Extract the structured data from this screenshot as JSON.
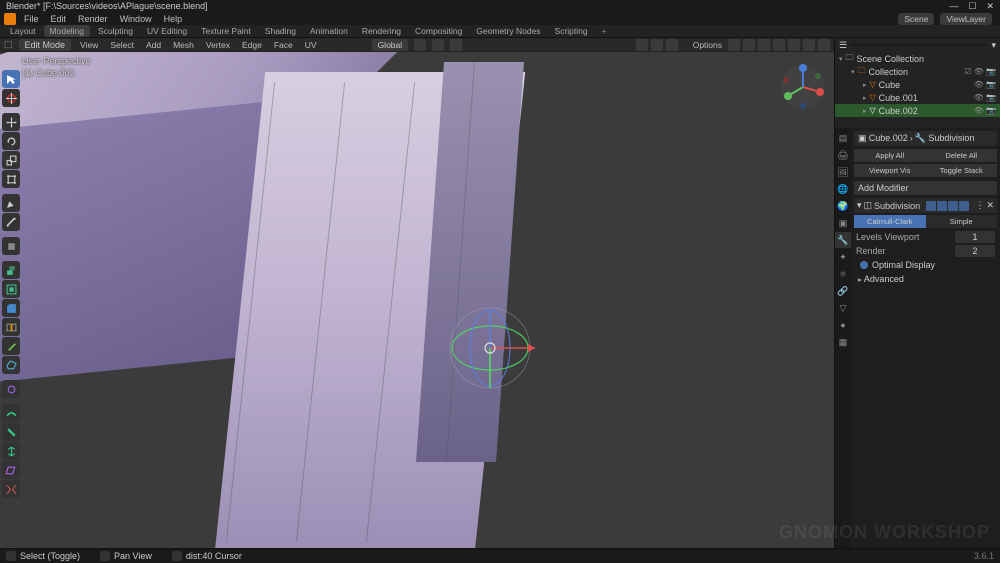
{
  "title": "Blender* [F:\\Sources\\videos\\APlague\\scene.blend]",
  "winbtns": [
    "—",
    "☐",
    "✕"
  ],
  "menu": [
    "File",
    "Edit",
    "Render",
    "Window",
    "Help"
  ],
  "workspaces": {
    "items": [
      "Layout",
      "Modeling",
      "Sculpting",
      "UV Editing",
      "Texture Paint",
      "Shading",
      "Animation",
      "Rendering",
      "Compositing",
      "Geometry Nodes",
      "Scripting"
    ],
    "active": 1,
    "plus": "+"
  },
  "scene_dd": "Scene",
  "viewlayer_dd": "ViewLayer",
  "viewport": {
    "mode_icon": "⬚",
    "mode": "Edit Mode",
    "menus": [
      "View",
      "Select",
      "Add",
      "Mesh",
      "Vertex",
      "Edge",
      "Face",
      "UV"
    ],
    "orient": "Global",
    "pivot": "⊙",
    "snap": "🧲",
    "overlay_line1": "User Perspective",
    "overlay_line2": "(1) Cube.002",
    "options": "Options",
    "version": "3.6.1"
  },
  "tools": [
    "select",
    "cursor",
    "move",
    "rotate",
    "scale",
    "transform",
    "annotate",
    "measure",
    "addcube",
    "extrude-region",
    "extrude-manifold",
    "inset",
    "bevel",
    "loopcut",
    "knife",
    "polybuild",
    "spin",
    "smooth",
    "slide-edge",
    "shrink",
    "shear",
    "rip",
    "rip-edge"
  ],
  "outliner": {
    "header": "Scene Collection",
    "rows": [
      {
        "depth": 1,
        "icon": "▸",
        "type": "📁",
        "label": "Collection",
        "toggles": "☑ 👁 📷"
      },
      {
        "depth": 2,
        "icon": "▾",
        "type": "▽",
        "label": "Cube",
        "toggles": "👁 📷"
      },
      {
        "depth": 2,
        "icon": "▾",
        "type": "▽",
        "label": "Cube.001",
        "toggles": "👁 📷"
      },
      {
        "depth": 2,
        "icon": "▾",
        "type": "▽",
        "label": "Cube.002",
        "toggles": "👁 📷",
        "sel": true
      }
    ]
  },
  "props": {
    "crumb_obj": "Cube.002",
    "crumb_mod": "Subdivision",
    "btns": [
      "Apply All",
      "Delete All",
      "Viewport Vis",
      "Toggle Stack"
    ],
    "addmod": "Add Modifier",
    "modname": "Subdivision",
    "tabs": [
      "Catmull-Clark",
      "Simple"
    ],
    "level_vp_lbl": "Levels Viewport",
    "level_vp": "1",
    "level_rn_lbl": "Render",
    "level_rn": "2",
    "optimal": "Optimal Display",
    "advanced": "Advanced"
  },
  "status": {
    "left": "Select (Toggle)",
    "mid": "Pan View",
    "right": "dist:40 Cursor"
  },
  "watermark": "GNOMON WORKSHOP"
}
